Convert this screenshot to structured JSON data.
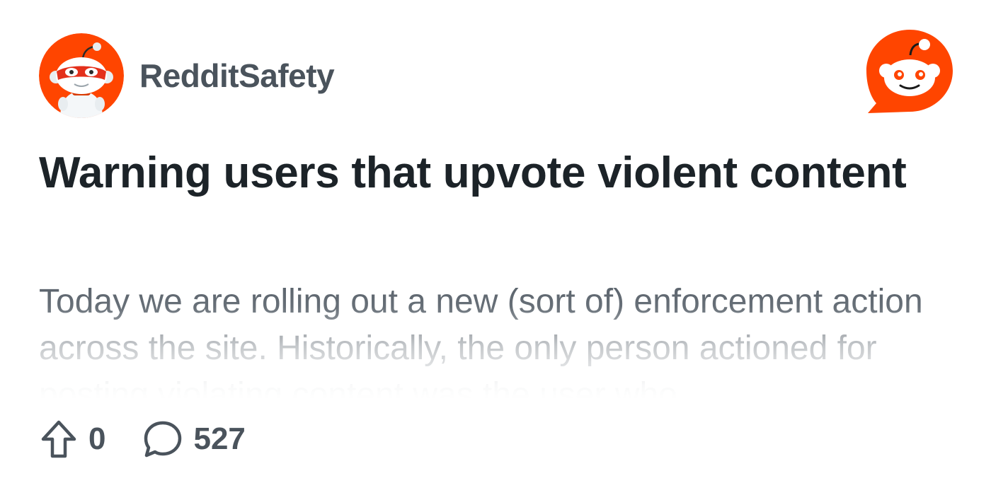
{
  "post": {
    "author": "RedditSafety",
    "title": "Warning users that upvote violent content",
    "excerpt": "Today we are rolling out a new (sort of) enforcement action across the site. Historically, the only person actioned for posting violating content was the user who",
    "vote_count": "0",
    "comment_count": "527"
  },
  "icons": {
    "avatar": "snoo-avatar",
    "brand": "reddit-logo-icon",
    "upvote": "upvote-arrow-icon",
    "comment": "comment-bubble-icon"
  },
  "colors": {
    "brand_orange": "#FF4500",
    "title_text": "#1C2328",
    "secondary_text": "#4A535C",
    "body_text": "#576069"
  }
}
